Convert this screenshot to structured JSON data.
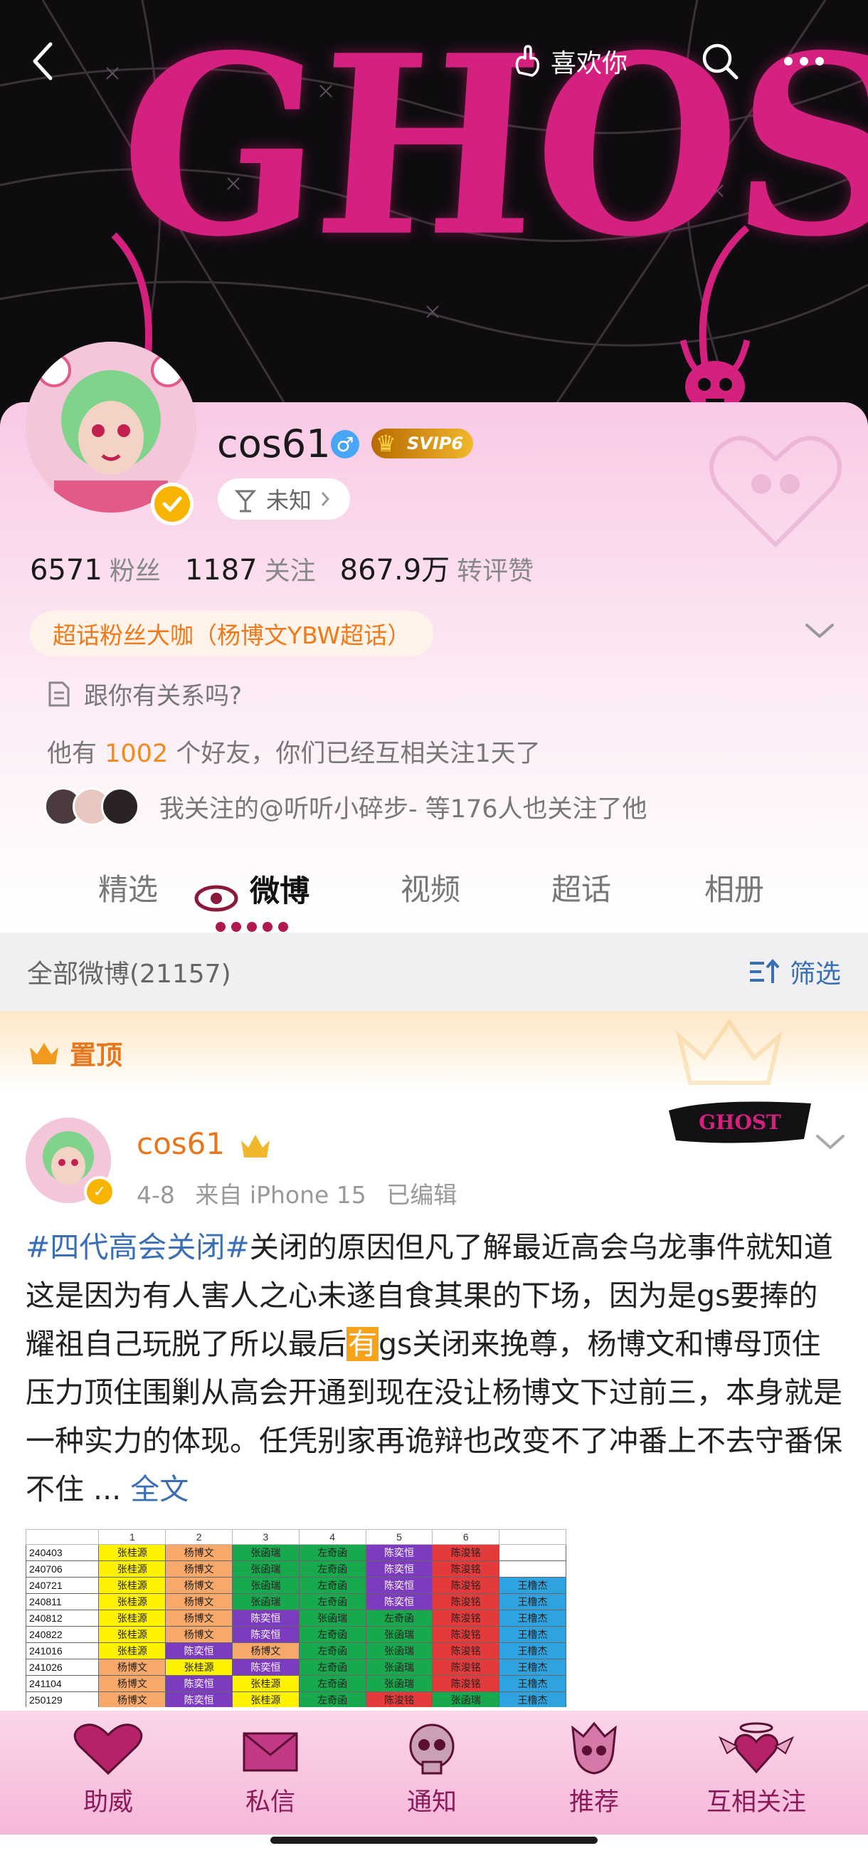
{
  "header": {
    "like_label": "喜欢你"
  },
  "banner": {
    "artwork_text": "GHOST"
  },
  "profile": {
    "name": "cos61",
    "svip_label": "SVIP6",
    "ip_location": "未知",
    "stats": [
      {
        "value": "6571",
        "label": "粉丝"
      },
      {
        "value": "1187",
        "label": "关注"
      },
      {
        "value": "867.9万",
        "label": "转评赞"
      }
    ],
    "super_badge": "超话粉丝大咖（杨博文YBW超话）",
    "relation_question": "跟你有关系吗?",
    "friends_prefix": "他有",
    "friends_count": "1002",
    "friends_suffix": "个好友，你们已经互相关注1天了",
    "mutual_text": "我关注的@听听小碎步- 等176人也关注了他"
  },
  "tabs": [
    {
      "label": "精选"
    },
    {
      "label": "微博"
    },
    {
      "label": "视频"
    },
    {
      "label": "超话"
    },
    {
      "label": "相册"
    }
  ],
  "list": {
    "count_label": "全部微博(21157)",
    "filter_label": "筛选"
  },
  "pinned": {
    "label": "置顶"
  },
  "post": {
    "author": "cos61",
    "date": "4-8",
    "source": "来自 iPhone 15",
    "edited": "已编辑",
    "hashtag": "#四代高会关闭#",
    "text_part1": "关闭的原因但凡了解最近高会乌龙事件就知道这是因为有人害人之心未遂自食其果的下场，因为是gs要捧的耀祖自己玩脱了所以最后",
    "highlight": "有",
    "text_part2": "gs关闭来挽尊，杨博文和博母顶住压力顶住围剿从高会开通到现在没让杨博文下过前三，本身就是一种实力的体现。任凭别家再诡辩也改变不了冲番上不去守番保不住",
    "ellipsis": "...",
    "full_text_label": "全文",
    "sticker_text": "GHOST"
  },
  "table": {
    "headers": [
      "",
      "1",
      "2",
      "3",
      "4",
      "5",
      "6",
      ""
    ],
    "rows": [
      [
        "240403",
        "张桂源",
        "杨博文",
        "张函瑞",
        "左奇函",
        "陈奕恒",
        "陈浚铭",
        ""
      ],
      [
        "240706",
        "张桂源",
        "杨博文",
        "张函瑞",
        "左奇函",
        "陈奕恒",
        "陈浚铭",
        ""
      ],
      [
        "240721",
        "张桂源",
        "杨博文",
        "张函瑞",
        "左奇函",
        "陈奕恒",
        "陈浚铭",
        "王橹杰"
      ],
      [
        "240811",
        "张桂源",
        "杨博文",
        "张函瑞",
        "左奇函",
        "陈奕恒",
        "陈浚铭",
        "王橹杰"
      ],
      [
        "240812",
        "张桂源",
        "杨博文",
        "陈奕恒",
        "张函瑞",
        "左奇函",
        "陈浚铭",
        "王橹杰"
      ],
      [
        "240822",
        "张桂源",
        "杨博文",
        "陈奕恒",
        "左奇函",
        "张函瑞",
        "陈浚铭",
        "王橹杰"
      ],
      [
        "241016",
        "张桂源",
        "陈奕恒",
        "杨博文",
        "左奇函",
        "张函瑞",
        "陈浚铭",
        "王橹杰"
      ],
      [
        "241026",
        "杨博文",
        "张桂源",
        "陈奕恒",
        "左奇函",
        "张函瑞",
        "陈浚铭",
        "王橹杰"
      ],
      [
        "241104",
        "杨博文",
        "陈奕恒",
        "张桂源",
        "左奇函",
        "张函瑞",
        "陈浚铭",
        "王橹杰"
      ],
      [
        "250129",
        "杨博文",
        "陈奕恒",
        "张桂源",
        "左奇函",
        "陈浚铭",
        "张函瑞",
        "王橹杰"
      ]
    ],
    "member_colors": {
      "张桂源": "#fff200",
      "杨博文": "#f7a96b",
      "张函瑞": "#18a84d",
      "左奇函": "#18a84d",
      "陈奕恒": "#7d3cc0",
      "陈浚铭": "#e33b3b",
      "王橹杰": "#2ea3e0"
    }
  },
  "bottom_nav": [
    {
      "label": "助威",
      "icon": "heart-icon"
    },
    {
      "label": "私信",
      "icon": "envelope-icon"
    },
    {
      "label": "通知",
      "icon": "skull-icon"
    },
    {
      "label": "推荐",
      "icon": "spiky-skull-icon"
    },
    {
      "label": "互相关注",
      "icon": "winged-heart-icon"
    }
  ],
  "colors": {
    "accent_pink": "#d4207e",
    "link_blue": "#3a6fb5",
    "orange": "#e8761c",
    "verified_gold": "#f7b500"
  }
}
